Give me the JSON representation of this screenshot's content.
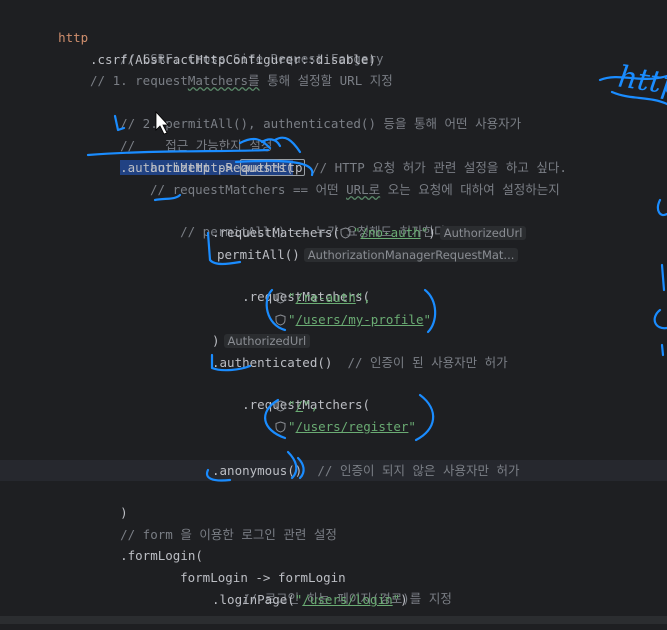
{
  "code": {
    "l_http": "http",
    "l_csrf_comment": "// CSRF: Cross Site Request Forgery",
    "l_csrf_dot": ".",
    "l_csrf_fn": "csrf",
    "l_csrf_arg": "(AbstractHttpConfigurer::disable)",
    "l_cmt1a": "// 1. request",
    "l_cmt1b": "Matchers를",
    "l_cmt1c": " 통해 설정할 URL 지정",
    "l_cmt2": "// 2. permitAll(), authenticated() 등을 통해 어떤 사용자가",
    "l_cmt3": "//    접근 가능한지 설정",
    "l_authreq": ".authorizeHttpRequests(",
    "l_lambda_a": "authHttp -> ",
    "l_lambda_b": "authHttp",
    "l_lambda_cmt": " // HTTP 요청 허가 관련 설정을 하고 싶다.",
    "l_cmt4a": "// requestMatchers == 어떤 ",
    "l_cmt4b": "URL로",
    "l_cmt4c": " 오는 요청에 대하여 설정하는지",
    "l_cmt5": "// permitAll() == 누가 요청해도 허가한다.",
    "l_rm1_a": ".requestMatchers(",
    "l_rm1_url": "/no-auth",
    "l_rm1_b": ")",
    "hint_authorized_url": "AuthorizedUrl",
    "l_permit": "permitAll()",
    "hint_manager": "AuthorizationManagerRequestMat...",
    "l_rm2": ".requestMatchers(",
    "l_url_reauth": "/re-auth",
    "l_url_profile": "/users/my-profile",
    "l_close": ")",
    "l_auth_a": ".authenticated()",
    "l_auth_cmt": "  // 인증이 된 사용자만 허가",
    "l_rm3": ".requestMatchers(",
    "l_url_root": "/",
    "l_url_register": "/users/register",
    "l_close2": ")",
    "l_anon_a": ".anonymous()",
    "l_anon_cmt": "  // 인증이 되지 않은 사용자만 허가",
    "l_close3": ")",
    "l_form_cmt": "// form 을 이용한 로그인 관련 설정",
    "l_formlogin": ".formLogin(",
    "l_formlambda": "formLogin -> formLogin",
    "l_login_cmt": "// 로그인 하는 페이지(경로)를 지정",
    "l_loginpage_a": ".loginPage(",
    "l_loginpage_url": "/users/login",
    "l_loginpage_b": ")"
  },
  "annotations": {
    "handwriting": "http"
  },
  "colors": {
    "background": "#1e1f22",
    "keyword": "#cf8e6d",
    "comment": "#7a7e85",
    "string": "#6aab73",
    "ink": "#1a8cff"
  }
}
